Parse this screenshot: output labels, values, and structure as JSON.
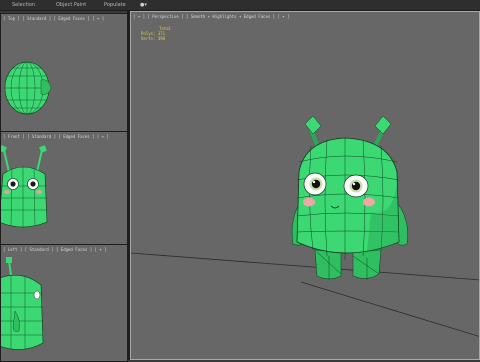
{
  "menubar": {
    "items": [
      "Selection",
      "Object Paint",
      "Populate"
    ]
  },
  "viewports": {
    "top": {
      "label": "[ Top ] [ Standard ] [ Edged Faces ] [ + ]"
    },
    "front": {
      "label": "[ Front ] [ Standard ] [ Edged Faces ] [ + ]"
    },
    "left": {
      "label": "[ Left ] [ Standard ] [ Edged Faces ] [ + ]"
    },
    "perspective": {
      "label": "[ + ] [ Perspective ] [ Smooth + Highlights + Edged Faces ] [ + ]",
      "stats": {
        "total_label": "Total",
        "polys_label": "Polys: 371",
        "verts_label": "Verts: 390"
      }
    }
  },
  "colors": {
    "model": "#3cd873",
    "model_dark": "#1f9a4d",
    "wire": "#0c3a1a",
    "viewport_bg": "#676767",
    "hud": "#e2d03a"
  }
}
